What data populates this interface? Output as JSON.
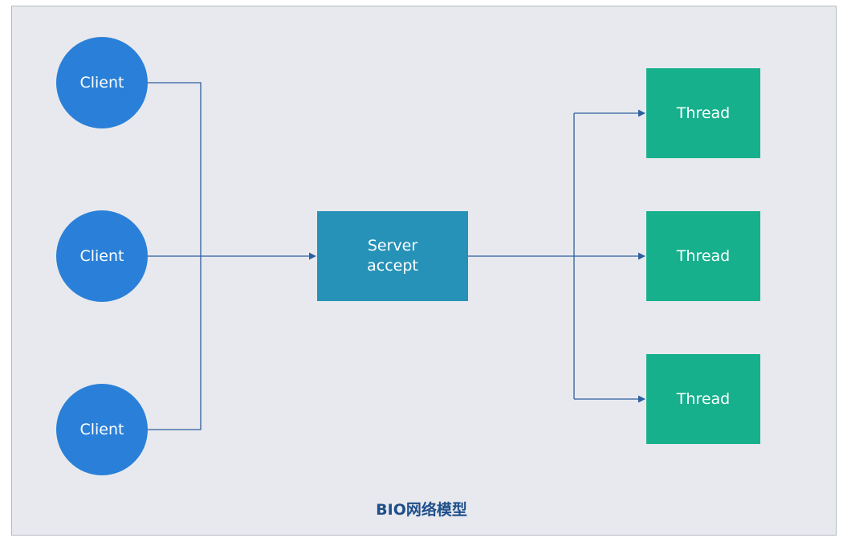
{
  "diagram": {
    "clients": [
      {
        "label": "Client"
      },
      {
        "label": "Client"
      },
      {
        "label": "Client"
      }
    ],
    "server": {
      "line1": "Server",
      "line2": "accept"
    },
    "threads": [
      {
        "label": "Thread"
      },
      {
        "label": "Thread"
      },
      {
        "label": "Thread"
      }
    ],
    "caption": "BIO网络模型",
    "colors": {
      "client": "#2a80d8",
      "server": "#2692b8",
      "thread": "#17b08d",
      "connector": "#2c5f9e",
      "background": "#e8e9ee"
    }
  }
}
